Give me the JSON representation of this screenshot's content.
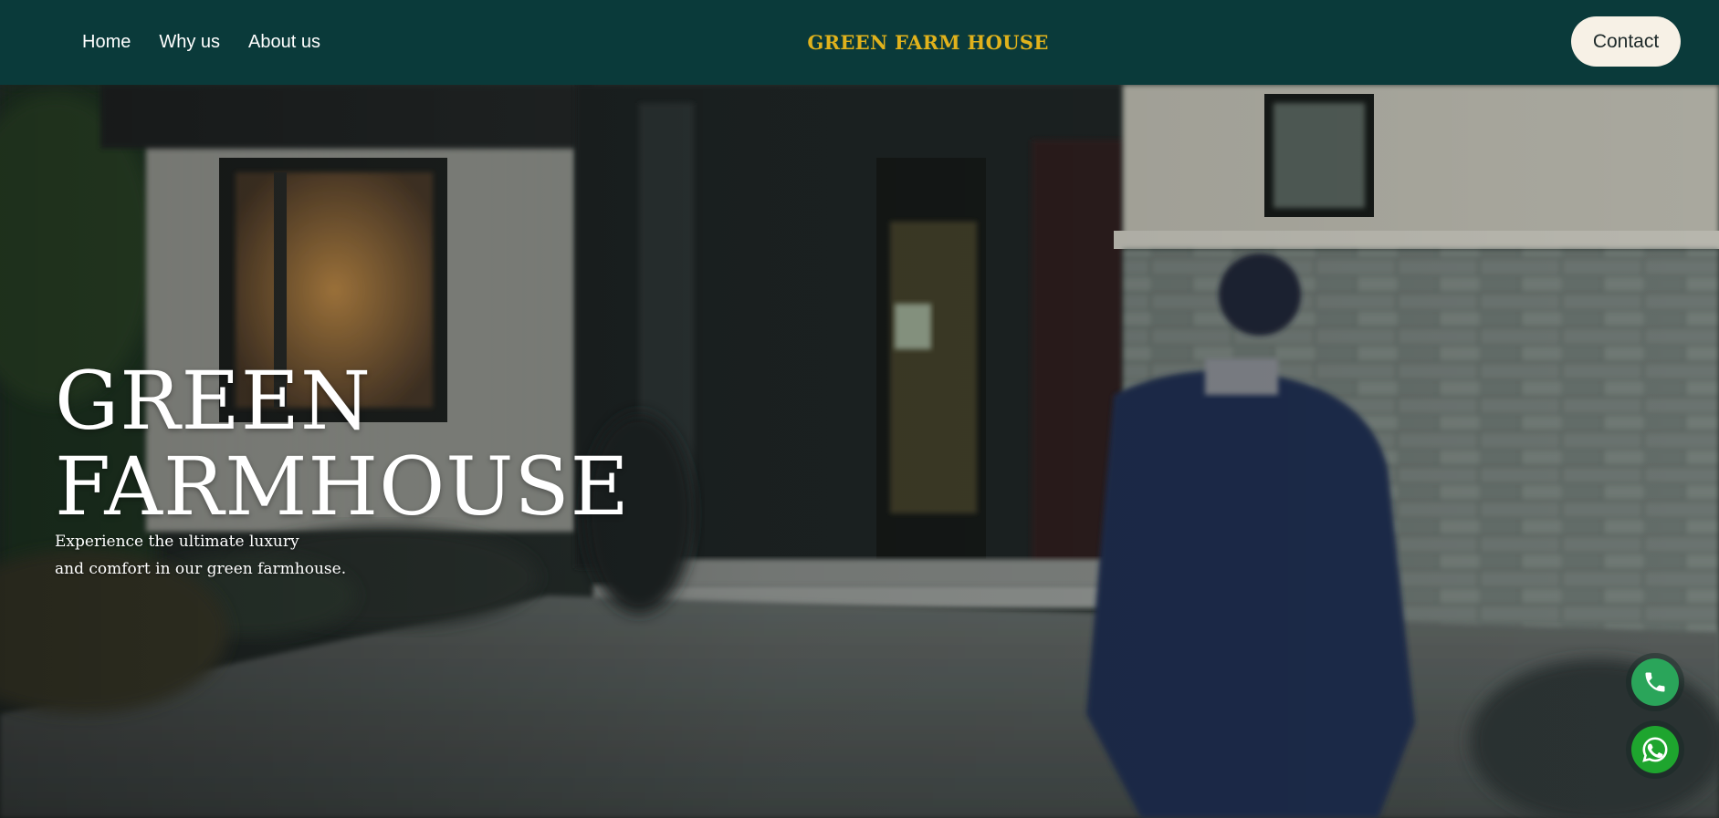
{
  "header": {
    "nav": [
      {
        "label": "Home"
      },
      {
        "label": "Why us"
      },
      {
        "label": "About us"
      }
    ],
    "brand": "GREEN FARM HOUSE",
    "contact_label": "Contact"
  },
  "hero": {
    "title_line1": "GREEN",
    "title_line2": "FARMHOUSE",
    "subtitle_line1": "Experience the ultimate luxury",
    "subtitle_line2": "and comfort in our green farmhouse."
  },
  "floating": {
    "phone_icon": "phone-icon",
    "whatsapp_icon": "whatsapp-icon"
  },
  "colors": {
    "header_bg": "#0a3a3a",
    "brand": "#e0b21c",
    "contact_bg": "#f7f1e6",
    "phone_bg": "#2aa55a",
    "whatsapp_bg": "#1ea52e"
  }
}
